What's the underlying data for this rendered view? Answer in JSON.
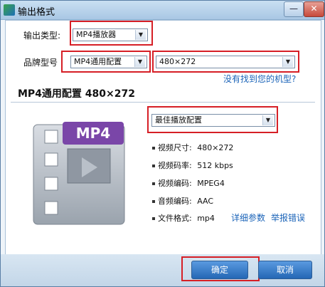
{
  "window": {
    "title": "输出格式",
    "minimize_glyph": "—",
    "close_glyph": "✕"
  },
  "output_type": {
    "label": "输出类型:",
    "value": "MP4播放器"
  },
  "brand": {
    "label": "品牌型号",
    "value": "MP4通用配置",
    "resolution": "480×272",
    "not_found_link": "没有找到您的机型?"
  },
  "section": {
    "title": "MP4通用配置 480×272"
  },
  "preview": {
    "format_badge": "MP4"
  },
  "quality": {
    "value": "最佳播放配置"
  },
  "specs": [
    {
      "label": "视频尺寸:",
      "value": "480×272"
    },
    {
      "label": "视频码率:",
      "value": "512 kbps"
    },
    {
      "label": "视频编码:",
      "value": "MPEG4"
    },
    {
      "label": "音频编码:",
      "value": "AAC"
    },
    {
      "label": "文件格式:",
      "value": "mp4"
    }
  ],
  "links": {
    "details": "详细参数",
    "report": "举报错误"
  },
  "buttons": {
    "ok": "确定",
    "cancel": "取消"
  },
  "colors": {
    "accent": "#2467b5",
    "highlight_box": "#d61f26",
    "mp4_badge": "#7a46a8"
  },
  "icons": {
    "film": "film-icon",
    "dropdown": "chevron-down-icon"
  }
}
